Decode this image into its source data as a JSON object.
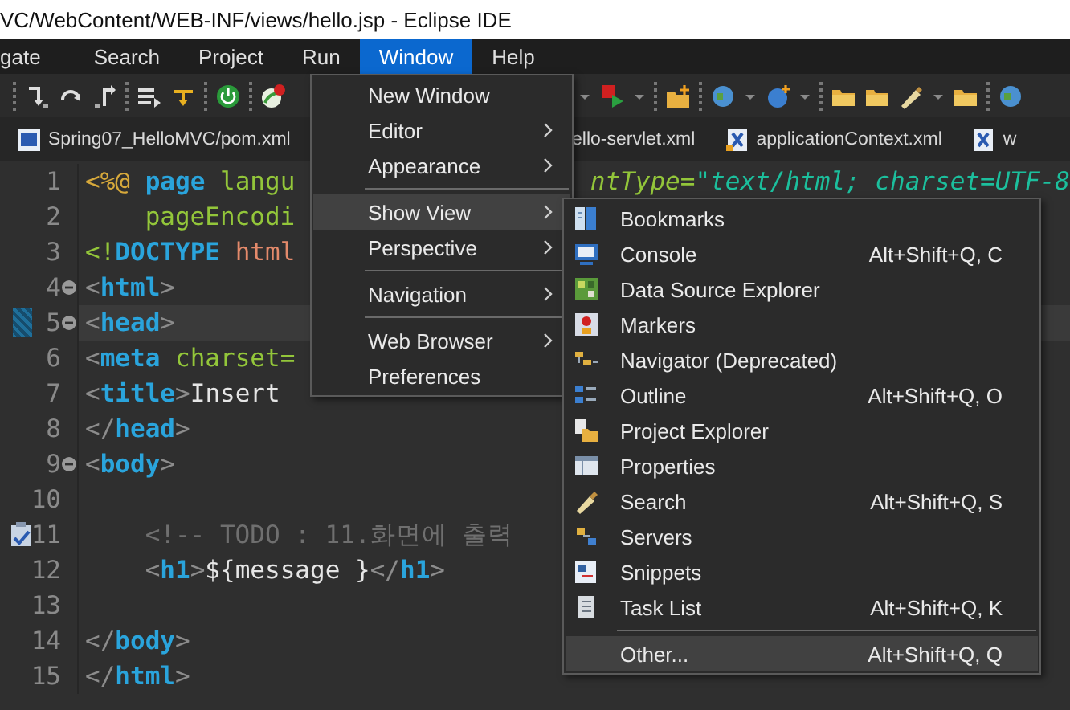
{
  "window": {
    "title": "VC/WebContent/WEB-INF/views/hello.jsp - Eclipse IDE"
  },
  "menubar": [
    {
      "label": "gate",
      "selected": false
    },
    {
      "label": "Search",
      "selected": false
    },
    {
      "label": "Project",
      "selected": false
    },
    {
      "label": "Run",
      "selected": false
    },
    {
      "label": "Window",
      "selected": true
    },
    {
      "label": "Help",
      "selected": false
    }
  ],
  "tabs": [
    {
      "label": "Spring07_HelloMVC/pom.xml",
      "kind": "maven"
    },
    {
      "label": "ello-servlet.xml",
      "kind": "plain"
    },
    {
      "label": "applicationContext.xml",
      "kind": "spring"
    },
    {
      "label": "w",
      "kind": "xml"
    }
  ],
  "editor": {
    "lines": [
      {
        "number": "1",
        "fold": false,
        "current": false,
        "task": false,
        "indented": false,
        "tokens": [
          {
            "kind": "directive",
            "text": "<%@ "
          },
          {
            "kind": "keyword",
            "text": "page "
          },
          {
            "kind": "attr",
            "text": "langu"
          }
        ],
        "tail": [
          {
            "kind": "attr",
            "text": "ntType="
          },
          {
            "kind": "string",
            "text": "\"text/html; charset=UTF-8"
          }
        ]
      },
      {
        "number": "2",
        "fold": false,
        "current": false,
        "task": false,
        "indented": true,
        "tokens": [
          {
            "kind": "attr",
            "text": "pageEncodi"
          }
        ]
      },
      {
        "number": "3",
        "fold": false,
        "current": false,
        "task": false,
        "indented": false,
        "tokens": [
          {
            "kind": "attr",
            "text": "<!"
          },
          {
            "kind": "keyword",
            "text": "DOCTYPE "
          },
          {
            "kind": "doctype",
            "text": "html"
          }
        ]
      },
      {
        "number": "4",
        "fold": true,
        "current": false,
        "task": false,
        "indented": false,
        "tokens": [
          {
            "kind": "bracket",
            "text": "<"
          },
          {
            "kind": "tag",
            "text": "html"
          },
          {
            "kind": "bracket",
            "text": ">"
          }
        ]
      },
      {
        "number": "5",
        "fold": true,
        "current": true,
        "task": false,
        "indented": false,
        "tokens": [
          {
            "kind": "bracket",
            "text": "<"
          },
          {
            "kind": "tag",
            "text": "head"
          },
          {
            "kind": "bracket",
            "text": ">"
          }
        ]
      },
      {
        "number": "6",
        "fold": false,
        "current": false,
        "task": false,
        "indented": false,
        "tokens": [
          {
            "kind": "bracket",
            "text": "<"
          },
          {
            "kind": "tag",
            "text": "meta "
          },
          {
            "kind": "attr",
            "text": "charset="
          }
        ]
      },
      {
        "number": "7",
        "fold": false,
        "current": false,
        "task": false,
        "indented": false,
        "tokens": [
          {
            "kind": "bracket",
            "text": "<"
          },
          {
            "kind": "tag",
            "text": "title"
          },
          {
            "kind": "bracket",
            "text": ">"
          },
          {
            "kind": "plain",
            "text": "Insert"
          }
        ]
      },
      {
        "number": "8",
        "fold": false,
        "current": false,
        "task": false,
        "indented": false,
        "tokens": [
          {
            "kind": "bracket",
            "text": "</"
          },
          {
            "kind": "tag",
            "text": "head"
          },
          {
            "kind": "bracket",
            "text": ">"
          }
        ]
      },
      {
        "number": "9",
        "fold": true,
        "current": false,
        "task": false,
        "indented": false,
        "tokens": [
          {
            "kind": "bracket",
            "text": "<"
          },
          {
            "kind": "tag",
            "text": "body"
          },
          {
            "kind": "bracket",
            "text": ">"
          }
        ]
      },
      {
        "number": "10",
        "fold": false,
        "current": false,
        "task": false
      },
      {
        "number": "11",
        "fold": false,
        "current": false,
        "task": true,
        "indented": true,
        "tokens": [
          {
            "kind": "comment",
            "text": "<!-- TODO : 11.화면에 출력"
          }
        ]
      },
      {
        "number": "12",
        "fold": false,
        "current": false,
        "task": false,
        "indented": true,
        "tokens": [
          {
            "kind": "bracket",
            "text": "<"
          },
          {
            "kind": "tag",
            "text": "h1"
          },
          {
            "kind": "bracket",
            "text": ">"
          },
          {
            "kind": "plain",
            "text": "${message }"
          },
          {
            "kind": "bracket",
            "text": "</"
          },
          {
            "kind": "tag",
            "text": "h1"
          },
          {
            "kind": "bracket",
            "text": ">"
          }
        ]
      },
      {
        "number": "13",
        "fold": false,
        "current": false,
        "task": false
      },
      {
        "number": "14",
        "fold": false,
        "current": false,
        "task": false,
        "indented": false,
        "tokens": [
          {
            "kind": "bracket",
            "text": "</"
          },
          {
            "kind": "tag",
            "text": "body"
          },
          {
            "kind": "bracket",
            "text": ">"
          }
        ]
      },
      {
        "number": "15",
        "fold": false,
        "current": false,
        "task": false,
        "indented": false,
        "tokens": [
          {
            "kind": "bracket",
            "text": "</"
          },
          {
            "kind": "tag",
            "text": "html"
          },
          {
            "kind": "bracket",
            "text": ">"
          }
        ]
      }
    ]
  },
  "window_menu": [
    {
      "kind": "item",
      "label": "New Window",
      "submenu": false,
      "selected": false
    },
    {
      "kind": "item",
      "label": "Editor",
      "submenu": true,
      "selected": false
    },
    {
      "kind": "item",
      "label": "Appearance",
      "submenu": true,
      "selected": false
    },
    {
      "kind": "separator"
    },
    {
      "kind": "item",
      "label": "Show View",
      "submenu": true,
      "selected": true
    },
    {
      "kind": "item",
      "label": "Perspective",
      "submenu": true,
      "selected": false
    },
    {
      "kind": "separator"
    },
    {
      "kind": "item",
      "label": "Navigation",
      "submenu": true,
      "selected": false
    },
    {
      "kind": "separator"
    },
    {
      "kind": "item",
      "label": "Web Browser",
      "submenu": true,
      "selected": false
    },
    {
      "kind": "item",
      "label": "Preferences",
      "submenu": false,
      "selected": false
    }
  ],
  "show_view_menu": [
    {
      "kind": "item",
      "label": "Bookmarks",
      "selected": false
    },
    {
      "kind": "item",
      "label": "Console",
      "shortcut": "Alt+Shift+Q, C",
      "selected": false
    },
    {
      "kind": "item",
      "label": "Data Source Explorer",
      "selected": false
    },
    {
      "kind": "item",
      "label": "Markers",
      "selected": false
    },
    {
      "kind": "item",
      "label": "Navigator (Deprecated)",
      "selected": false
    },
    {
      "kind": "item",
      "label": "Outline",
      "shortcut": "Alt+Shift+Q, O",
      "selected": false
    },
    {
      "kind": "item",
      "label": "Project Explorer",
      "selected": false
    },
    {
      "kind": "item",
      "label": "Properties",
      "selected": false
    },
    {
      "kind": "item",
      "label": "Search",
      "shortcut": "Alt+Shift+Q, S",
      "selected": false
    },
    {
      "kind": "item",
      "label": "Servers",
      "selected": false
    },
    {
      "kind": "item",
      "label": "Snippets",
      "selected": false
    },
    {
      "kind": "item",
      "label": "Task List",
      "shortcut": "Alt+Shift+Q, K",
      "selected": false
    },
    {
      "kind": "separator"
    },
    {
      "kind": "item",
      "label": "Other...",
      "shortcut": "Alt+Shift+Q, Q",
      "selected": true
    }
  ]
}
